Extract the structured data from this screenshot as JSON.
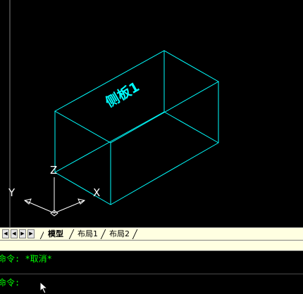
{
  "viewport": {
    "box_label": "侧板1",
    "ucs": {
      "x_label": "X",
      "y_label": "Y",
      "z_label": "Z"
    },
    "line_color": "#00ffff",
    "ucs_color": "#ffffff"
  },
  "tabs": {
    "nav_icons": [
      "first-tab-icon",
      "prev-tab-icon",
      "next-tab-icon",
      "last-tab-icon"
    ],
    "items": [
      {
        "label": "模型",
        "active": true
      },
      {
        "label": "布局1",
        "active": false
      },
      {
        "label": "布局2",
        "active": false
      }
    ]
  },
  "command": {
    "history_line": "命令: *取消*",
    "prompt": "命令:"
  }
}
